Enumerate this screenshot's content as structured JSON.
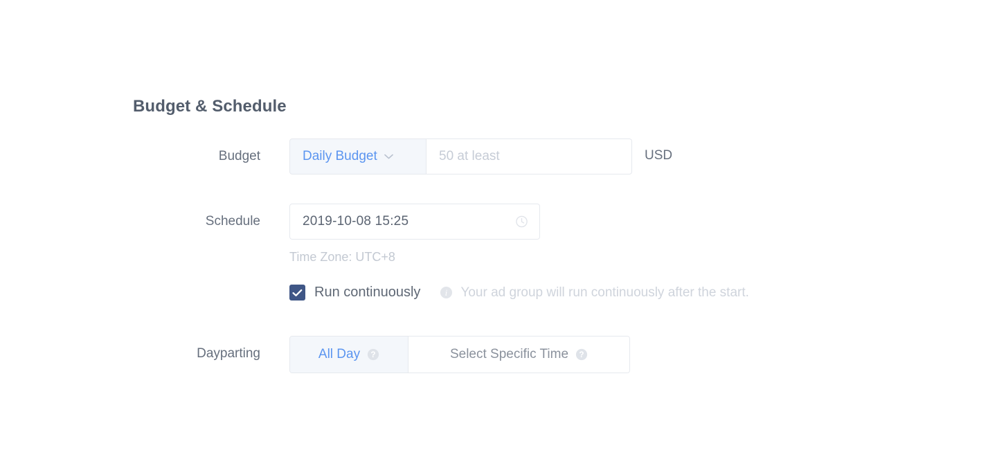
{
  "section": {
    "title": "Budget & Schedule"
  },
  "budget": {
    "label": "Budget",
    "type_value": "Daily Budget",
    "type_icon": "chevron-down-icon",
    "amount_value": "",
    "amount_placeholder": "50 at least",
    "currency": "USD"
  },
  "schedule": {
    "label": "Schedule",
    "datetime_value": "2019-10-08 15:25",
    "datetime_icon": "clock-icon",
    "timezone_note": "Time Zone: UTC+8",
    "run_continuously": {
      "label": "Run continuously",
      "checked": true,
      "hint_icon": "info-icon",
      "hint_text": "Your ad group will run continuously after the start.",
      "hint_glyph": "i"
    }
  },
  "dayparting": {
    "label": "Dayparting",
    "options": [
      {
        "label": "All Day",
        "active": true,
        "help_icon": "help-icon",
        "help_glyph": "?"
      },
      {
        "label": "Select Specific Time",
        "active": false,
        "help_icon": "help-icon",
        "help_glyph": "?"
      }
    ]
  },
  "colors": {
    "accent_blue": "#5b95f0",
    "checkbox_navy": "#3f5686",
    "label_grey": "#666f7d",
    "muted_grey": "#cfd4dc",
    "border": "#e6e9ee",
    "tab_active_bg": "#f4f7fb"
  }
}
